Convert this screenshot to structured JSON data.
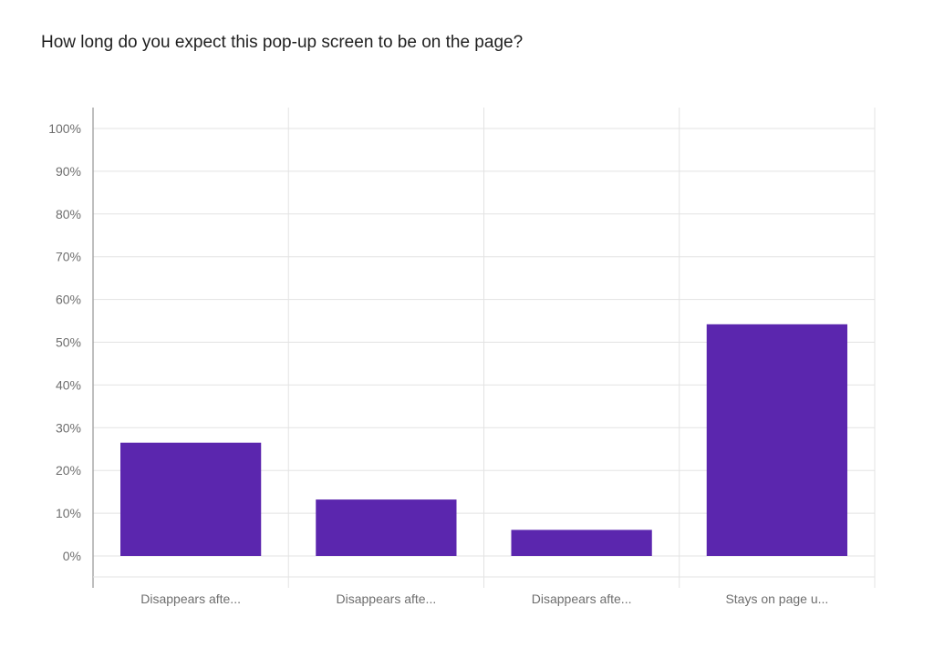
{
  "question": {
    "title": "How long do you expect this pop-up screen to be on the page?"
  },
  "colors": {
    "bar": "#5b26ae",
    "grid": "#e3e3e3",
    "axis": "#a8a8a8",
    "tick_text": "#6e6e6e",
    "title_text": "#1f1f1f"
  },
  "chart_data": {
    "type": "bar",
    "title": "How long do you expect this pop-up screen to be on the page?",
    "categories": [
      "Disappears afte...",
      "Disappears afte...",
      "Disappears afte...",
      "Stays on page u..."
    ],
    "values": [
      26.5,
      13.2,
      6.1,
      54.2
    ],
    "ylim": [
      0,
      100
    ],
    "y_ticks": [
      "0%",
      "10%",
      "20%",
      "30%",
      "40%",
      "50%",
      "60%",
      "70%",
      "80%",
      "90%",
      "100%"
    ],
    "y_tick_values": [
      0,
      10,
      20,
      30,
      40,
      50,
      60,
      70,
      80,
      90,
      100
    ],
    "unit": "%",
    "xlabel": "",
    "ylabel": "",
    "grid": true,
    "legend": false
  }
}
